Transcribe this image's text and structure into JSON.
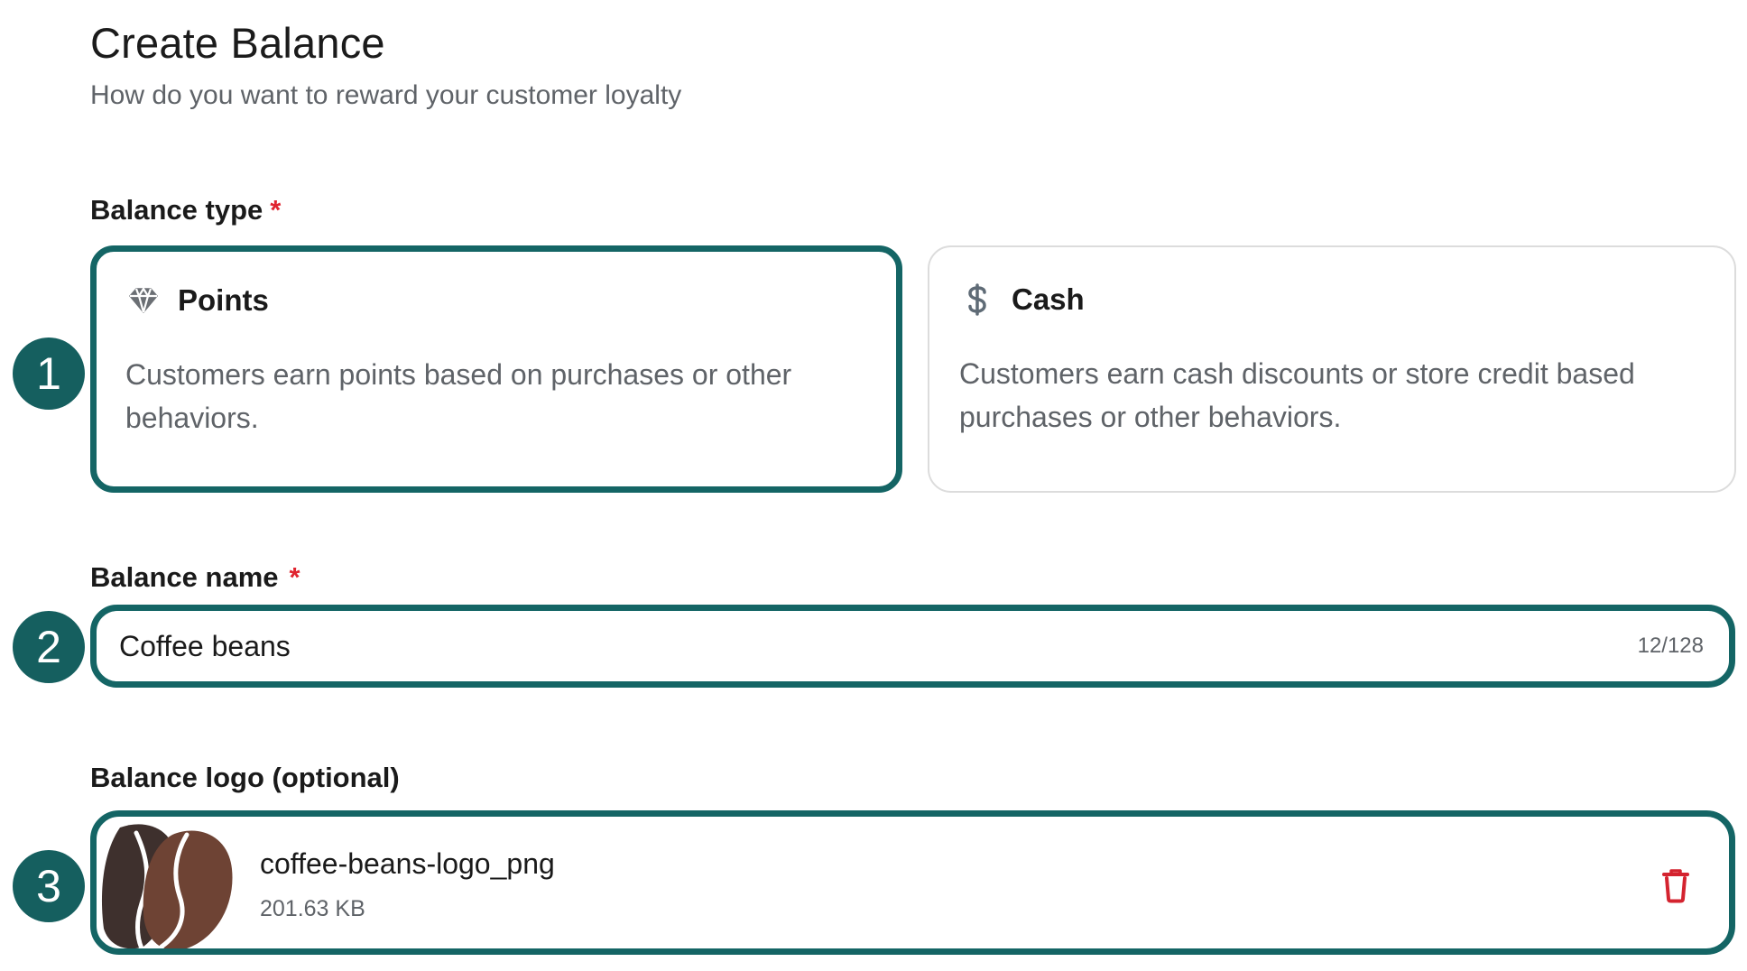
{
  "header": {
    "title": "Create Balance",
    "subtitle": "How do you want to reward your customer loyalty"
  },
  "balance_type": {
    "label": "Balance type",
    "required_mark": "*",
    "step": "1",
    "options": [
      {
        "title": "Points",
        "icon": "diamond-icon",
        "description": "Customers earn points based on purchases or other behaviors.",
        "selected": true
      },
      {
        "title": "Cash",
        "icon": "dollar-icon",
        "description": "Customers earn cash discounts or store credit based purchases or other behaviors.",
        "selected": false
      }
    ]
  },
  "balance_name": {
    "label": "Balance name",
    "required_mark": "*",
    "step": "2",
    "value": "Coffee beans",
    "char_count": "12/128"
  },
  "balance_logo": {
    "label": "Balance logo (optional)",
    "step": "3",
    "file_name": "coffee-beans-logo_png",
    "file_size": "201.63 KB",
    "delete_icon": "trash-icon"
  },
  "colors": {
    "accent": "#146565",
    "badge": "#155f5f",
    "required": "#e0242f",
    "delete": "#d4232f",
    "bean_dark": "#3e302d",
    "bean_light": "#6e4334"
  }
}
